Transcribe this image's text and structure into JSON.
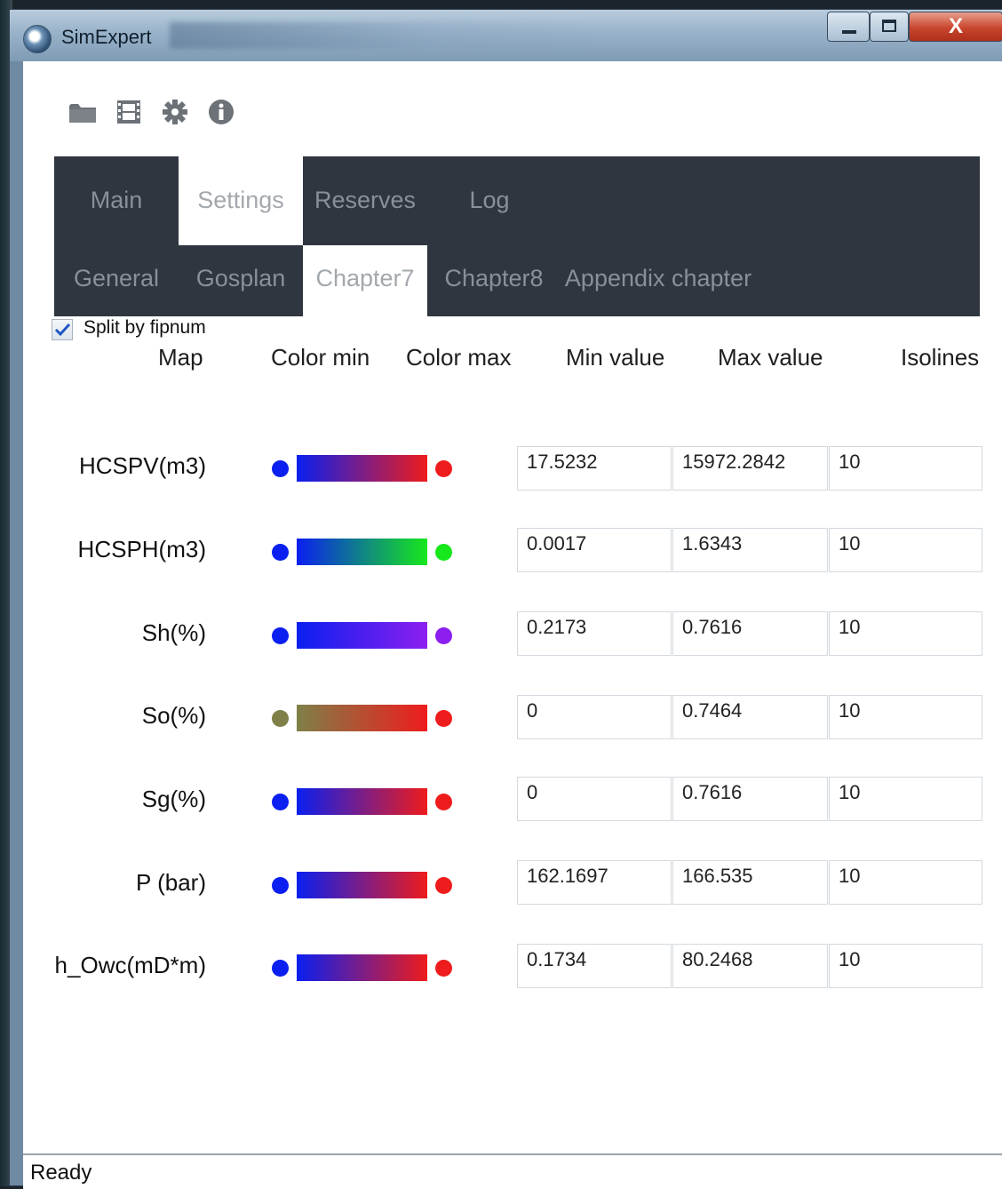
{
  "window": {
    "title": "SimExpert",
    "close_glyph": "X"
  },
  "toolbar": {
    "icons": [
      "folder-icon",
      "film-icon",
      "gear-icon",
      "info-icon"
    ]
  },
  "tabs": {
    "main": [
      {
        "label": "Main",
        "active": false
      },
      {
        "label": "Settings",
        "active": true
      },
      {
        "label": "Reserves",
        "active": false
      },
      {
        "label": "Log",
        "active": false
      }
    ],
    "sub": [
      {
        "label": "General",
        "active": false
      },
      {
        "label": "Gosplan",
        "active": false
      },
      {
        "label": "Chapter7",
        "active": true
      },
      {
        "label": "Chapter8",
        "active": false
      },
      {
        "label": "Appendix chapter",
        "active": false
      }
    ]
  },
  "split_checkbox": {
    "label": "Split by fipnum",
    "checked": true
  },
  "columns": [
    "Map",
    "Color min",
    "Color max",
    "Min value",
    "Max value",
    "Isolines"
  ],
  "rows": [
    {
      "map": "HCSPV(m3)",
      "color_min": "#0a1ff0",
      "color_max": "#ee1c1c",
      "min": "17.5232",
      "max": "15972.2842",
      "isolines": "10"
    },
    {
      "map": "HCSPH(m3)",
      "color_min": "#0a1ff0",
      "color_max": "#17e81c",
      "min": "0.0017",
      "max": "1.6343",
      "isolines": "10"
    },
    {
      "map": "Sh(%)",
      "color_min": "#0a1ff0",
      "color_max": "#8c1ff0",
      "min": "0.2173",
      "max": "0.7616",
      "isolines": "10"
    },
    {
      "map": "So(%)",
      "color_min": "#7e8048",
      "color_max": "#ee1c1c",
      "min": "0",
      "max": "0.7464",
      "isolines": "10"
    },
    {
      "map": "Sg(%)",
      "color_min": "#0a1ff0",
      "color_max": "#ee1c1c",
      "min": "0",
      "max": "0.7616",
      "isolines": "10"
    },
    {
      "map": "P (bar)",
      "color_min": "#0a1ff0",
      "color_max": "#ee1c1c",
      "min": "162.1697",
      "max": "166.535",
      "isolines": "10"
    },
    {
      "map": "h_Owc(mD*m)",
      "color_min": "#0a1ff0",
      "color_max": "#ee1c1c",
      "min": "0.1734",
      "max": "80.2468",
      "isolines": "10"
    }
  ],
  "status": {
    "text": "Ready"
  },
  "colors": {
    "tabbar_bg": "#2f363f",
    "tab_text": "#8a9098"
  }
}
